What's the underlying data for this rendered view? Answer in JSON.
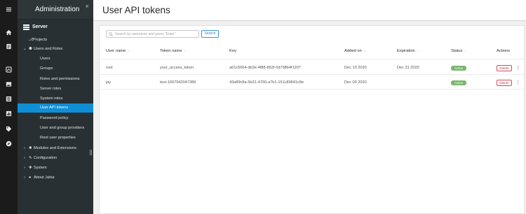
{
  "header": {
    "title": "User API tokens"
  },
  "sidebar": {
    "title": "Administration",
    "collapse_glyph": "«",
    "section": "Server",
    "items": [
      {
        "label": "Projects",
        "glyph": "⎇"
      },
      {
        "label": "Users and Roles",
        "caret": "⌄",
        "glyph": "⚉"
      },
      {
        "label": "Users"
      },
      {
        "label": "Groups"
      },
      {
        "label": "Roles and permissions"
      },
      {
        "label": "Server roles"
      },
      {
        "label": "System roles"
      },
      {
        "label": "User API tokens"
      },
      {
        "label": "Password policy"
      },
      {
        "label": "User and group providers"
      },
      {
        "label": "Root user properties"
      },
      {
        "label": "Modules and Extensions",
        "caret": "›",
        "glyph": "✱"
      },
      {
        "label": "Configuration",
        "caret": "›",
        "glyph": "✎"
      },
      {
        "label": "System",
        "caret": "›",
        "glyph": "✚"
      },
      {
        "label": "About Jahia",
        "caret": "›",
        "glyph": "●"
      }
    ]
  },
  "rail": {
    "icons": [
      "menu-icon",
      "home-icon",
      "document-icon",
      "dashboard-icon",
      "image-icon",
      "form-icon",
      "chart-icon",
      "tag-icon",
      "compass-icon"
    ]
  },
  "search": {
    "placeholder": "Search by username and press \"Enter\"",
    "button_label": "Search"
  },
  "table": {
    "columns": [
      "User name",
      "Token name",
      "Key",
      "Added on",
      "Expiration",
      "Status",
      "Actions"
    ],
    "sorted_column": "Added on",
    "sort_glyph": "↕",
    "sort_active_glyph": "↓",
    "rows": [
      {
        "user": "root",
        "token": "your_access_token",
        "key": "a61c5664-db3e-4f88-862f-0d798b4f1207",
        "added": "Dec 10 2020",
        "expiration": "Dec 31 2020",
        "status": "Active",
        "action": "Delete",
        "more": "⋮"
      },
      {
        "user": "jay",
        "token": "test-1607542047386",
        "key": "43a89c8a-5b31-4766-a7b1-151c89841c8e",
        "added": "Dec 09 2020",
        "expiration": "",
        "status": "Active",
        "action": "Delete",
        "more": "⋮"
      }
    ]
  },
  "colors": {
    "accent": "#0f8fd6",
    "status_active": "#78b66c",
    "delete": "#d0344b",
    "sidebar_bg": "#293033",
    "rail_bg": "#1b1b1b"
  }
}
